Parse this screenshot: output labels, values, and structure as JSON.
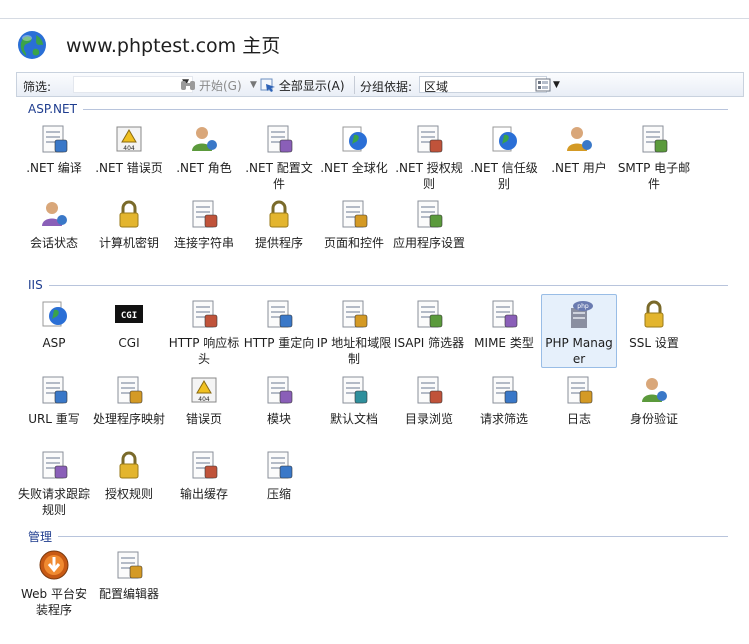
{
  "header": {
    "title": "www.phptest.com 主页",
    "icon": "globe-icon"
  },
  "toolbar": {
    "filter_label": "筛选:",
    "filter_value": "",
    "go_label": "开始(G)",
    "show_all_label": "全部显示(A)",
    "group_by_label": "分组依据:",
    "group_by_value": "区域"
  },
  "sections": [
    {
      "label": "ASP.NET",
      "items": [
        {
          "label": ".NET 编译",
          "icon": "dotnet-compile-icon"
        },
        {
          "label": ".NET 错误页",
          "icon": "dotnet-error-pages-icon"
        },
        {
          "label": ".NET 角色",
          "icon": "dotnet-roles-icon"
        },
        {
          "label": ".NET 配置文件",
          "icon": "dotnet-profile-icon"
        },
        {
          "label": ".NET 全球化",
          "icon": "dotnet-globalization-icon"
        },
        {
          "label": ".NET 授权规则",
          "icon": "dotnet-authorization-icon"
        },
        {
          "label": ".NET 信任级别",
          "icon": "dotnet-trust-levels-icon"
        },
        {
          "label": ".NET 用户",
          "icon": "dotnet-users-icon"
        },
        {
          "label": "SMTP 电子邮件",
          "icon": "smtp-email-icon"
        },
        {
          "label": "会话状态",
          "icon": "session-state-icon"
        },
        {
          "label": "计算机密钥",
          "icon": "machine-key-icon"
        },
        {
          "label": "连接字符串",
          "icon": "connection-strings-icon"
        },
        {
          "label": "提供程序",
          "icon": "providers-icon"
        },
        {
          "label": "页面和控件",
          "icon": "pages-controls-icon"
        },
        {
          "label": "应用程序设置",
          "icon": "app-settings-icon"
        }
      ]
    },
    {
      "label": "IIS",
      "items": [
        {
          "label": "ASP",
          "icon": "asp-icon"
        },
        {
          "label": "CGI",
          "icon": "cgi-icon"
        },
        {
          "label": "HTTP 响应标头",
          "icon": "http-response-headers-icon"
        },
        {
          "label": "HTTP 重定向",
          "icon": "http-redirect-icon"
        },
        {
          "label": "IP 地址和域限制",
          "icon": "ip-domain-restrictions-icon"
        },
        {
          "label": "ISAPI 筛选器",
          "icon": "isapi-filters-icon"
        },
        {
          "label": "MIME 类型",
          "icon": "mime-types-icon"
        },
        {
          "label": "PHP Manager",
          "icon": "php-manager-icon",
          "selected": true
        },
        {
          "label": "SSL 设置",
          "icon": "ssl-lock-icon"
        },
        {
          "label": "URL 重写",
          "icon": "url-rewrite-icon"
        },
        {
          "label": "处理程序映射",
          "icon": "handler-mappings-icon"
        },
        {
          "label": "错误页",
          "icon": "error-pages-icon"
        },
        {
          "label": "模块",
          "icon": "modules-icon"
        },
        {
          "label": "默认文档",
          "icon": "default-document-icon"
        },
        {
          "label": "目录浏览",
          "icon": "directory-browsing-icon"
        },
        {
          "label": "请求筛选",
          "icon": "request-filtering-icon"
        },
        {
          "label": "日志",
          "icon": "logging-icon"
        },
        {
          "label": "身份验证",
          "icon": "authentication-icon"
        },
        {
          "label": "失败请求跟踪规则",
          "icon": "failed-request-tracing-icon"
        },
        {
          "label": "授权规则",
          "icon": "authorization-rules-icon"
        },
        {
          "label": "输出缓存",
          "icon": "output-caching-icon"
        },
        {
          "label": "压缩",
          "icon": "compression-icon"
        }
      ]
    },
    {
      "label": "管理",
      "items": [
        {
          "label": "Web 平台安装程序",
          "icon": "web-platform-installer-icon"
        },
        {
          "label": "配置编辑器",
          "icon": "configuration-editor-icon"
        }
      ]
    }
  ],
  "colors": {
    "section_text": "#1f3d8f",
    "selected_bg": "#e6f0fb",
    "selected_border": "#99bde6"
  }
}
